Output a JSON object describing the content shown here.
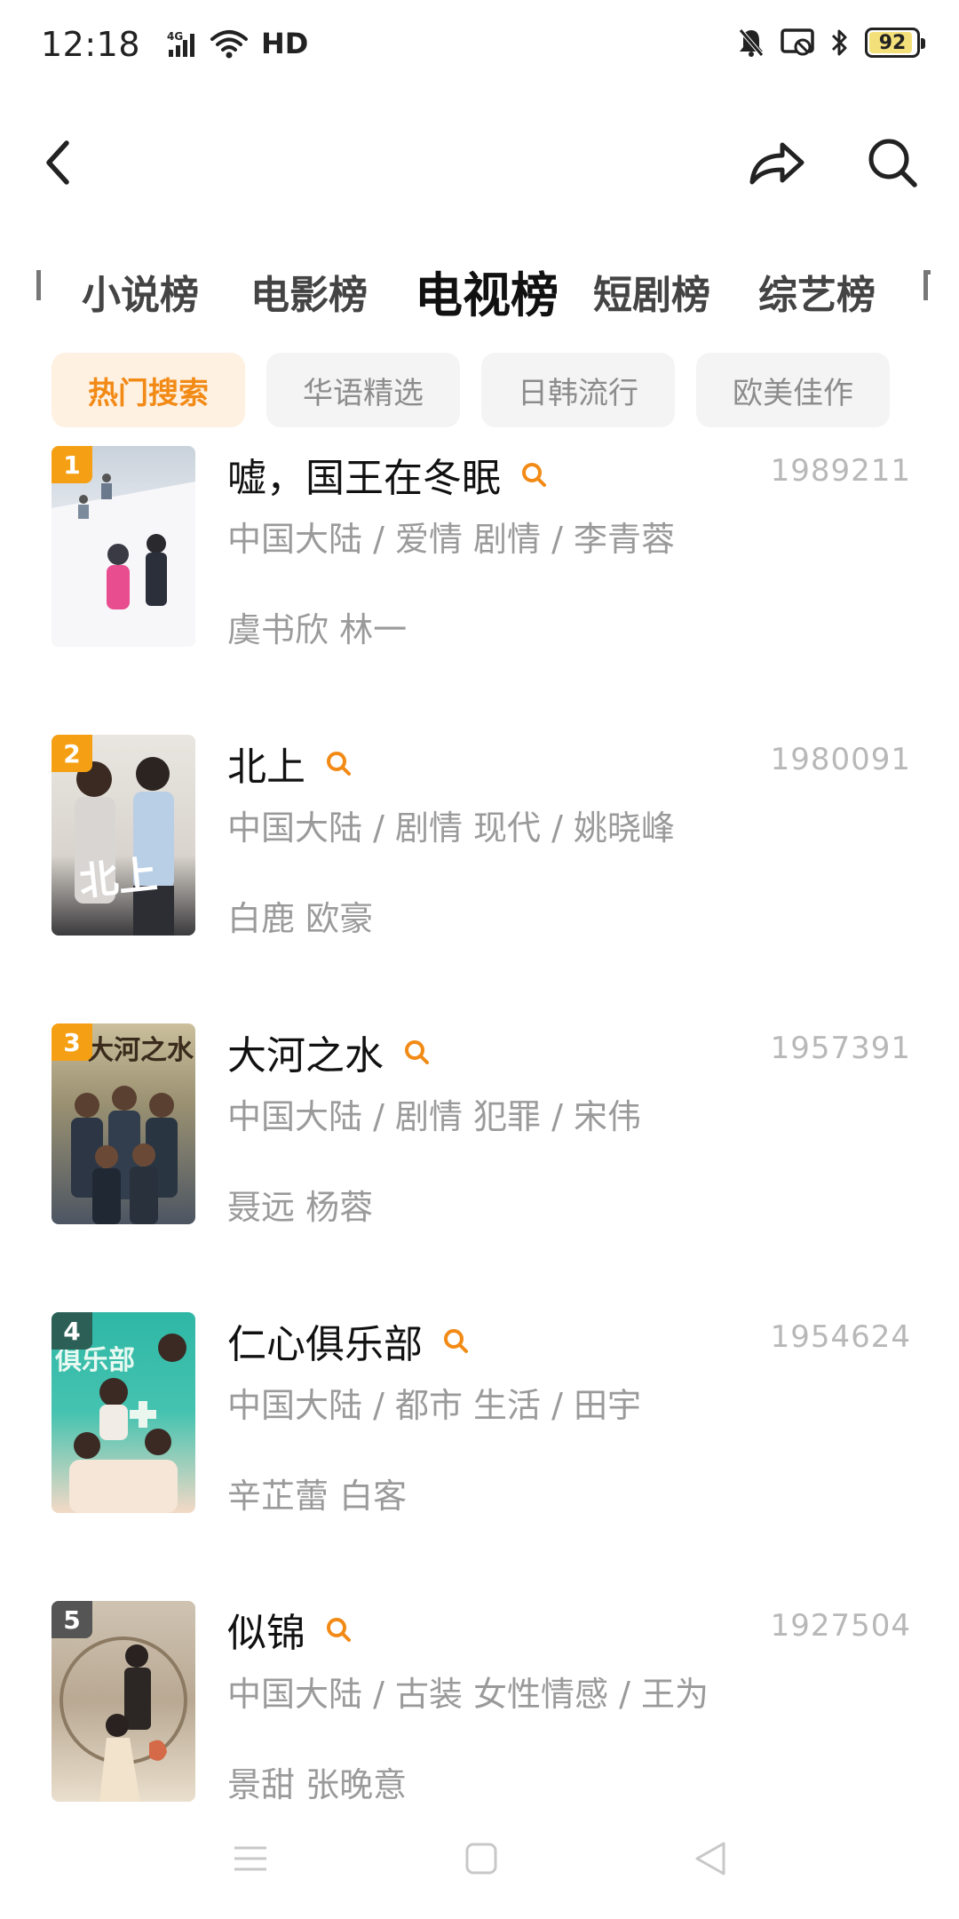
{
  "status_bar": {
    "time": "12:18",
    "network": "4G",
    "hd": "HD",
    "battery": "92",
    "battery_level": 0.92
  },
  "categories": [
    {
      "label": "小说榜"
    },
    {
      "label": "电影榜"
    },
    {
      "label": "电视榜"
    },
    {
      "label": "短剧榜"
    },
    {
      "label": "综艺榜"
    }
  ],
  "active_category": "电视榜",
  "chips": [
    {
      "label": "热门搜索"
    },
    {
      "label": "华语精选"
    },
    {
      "label": "日韩流行"
    },
    {
      "label": "欧美佳作"
    }
  ],
  "active_chip": "热门搜索",
  "items": [
    {
      "rank": "1",
      "title": "嘘，国王在冬眠",
      "score": "1989211",
      "meta": "中国大陆 / 爱情 剧情 / 李青蓉",
      "actors": "虞书欣 林一"
    },
    {
      "rank": "2",
      "title": "北上",
      "score": "1980091",
      "meta": "中国大陆 / 剧情 现代 / 姚晓峰",
      "actors": "白鹿 欧豪"
    },
    {
      "rank": "3",
      "title": "大河之水",
      "score": "1957391",
      "meta": "中国大陆 / 剧情 犯罪 / 宋伟",
      "actors": "聂远 杨蓉"
    },
    {
      "rank": "4",
      "title": "仁心俱乐部",
      "score": "1954624",
      "meta": "中国大陆 / 都市 生活 / 田宇",
      "actors": "辛芷蕾 白客"
    },
    {
      "rank": "5",
      "title": "似锦",
      "score": "1927504",
      "meta": "中国大陆 / 古装 女性情感 / 王为",
      "actors": "景甜 张晚意"
    }
  ],
  "colors": {
    "accent": "#f28a16",
    "rank_badge": "#f5a014",
    "muted_text": "#9a9a9a"
  },
  "icons": {
    "back": "chevron-left-icon",
    "share": "share-icon",
    "search": "search-icon"
  }
}
